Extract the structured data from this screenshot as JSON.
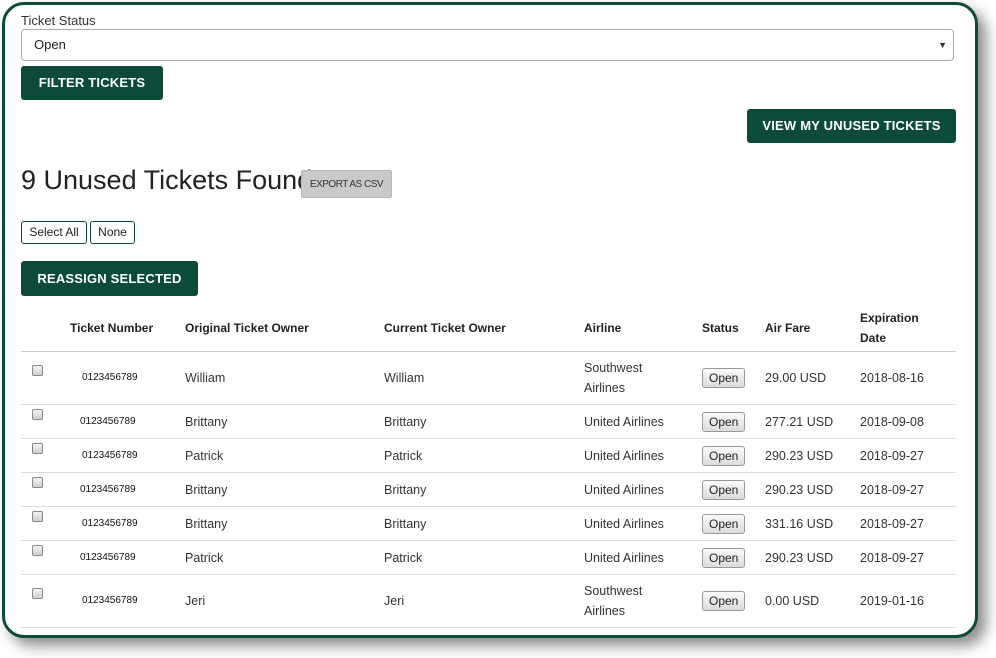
{
  "filter": {
    "label": "Ticket Status",
    "selected": "Open",
    "button": "FILTER TICKETS"
  },
  "view_button": "VIEW MY UNUSED TICKETS",
  "results": {
    "heading": "9 Unused Tickets Found",
    "export_button": "EXPORT AS CSV"
  },
  "selection": {
    "select_all": "Select All",
    "none": "None",
    "reassign": "REASSIGN SELECTED"
  },
  "table": {
    "headers": {
      "ticket_number": "Ticket Number",
      "original_owner": "Original Ticket Owner",
      "current_owner": "Current Ticket Owner",
      "airline": "Airline",
      "status": "Status",
      "air_fare": "Air Fare",
      "expiration_line1": "Expiration",
      "expiration_line2": "Date"
    },
    "rows": [
      {
        "ticket": "0123456789",
        "original": "William",
        "current": "William",
        "airline_l1": "Southwest",
        "airline_l2": "Airlines",
        "status": "Open",
        "fare": "29.00 USD",
        "expiration": "2018-08-16"
      },
      {
        "ticket": "0123456789",
        "original": "Brittany",
        "current": "Brittany",
        "airline_l1": "United Airlines",
        "airline_l2": "",
        "status": "Open",
        "fare": "277.21 USD",
        "expiration": "2018-09-08"
      },
      {
        "ticket": "0123456789",
        "original": "Patrick",
        "current": "Patrick",
        "airline_l1": "United Airlines",
        "airline_l2": "",
        "status": "Open",
        "fare": "290.23 USD",
        "expiration": "2018-09-27"
      },
      {
        "ticket": "0123456789",
        "original": "Brittany",
        "current": "Brittany",
        "airline_l1": "United Airlines",
        "airline_l2": "",
        "status": "Open",
        "fare": "290.23 USD",
        "expiration": "2018-09-27"
      },
      {
        "ticket": "0123456789",
        "original": "Brittany",
        "current": "Brittany",
        "airline_l1": "United Airlines",
        "airline_l2": "",
        "status": "Open",
        "fare": "331.16 USD",
        "expiration": "2018-09-27"
      },
      {
        "ticket": "0123456789",
        "original": "Patrick",
        "current": "Patrick",
        "airline_l1": "United Airlines",
        "airline_l2": "",
        "status": "Open",
        "fare": "290.23 USD",
        "expiration": "2018-09-27"
      },
      {
        "ticket": "0123456789",
        "original": "Jeri",
        "current": "Jeri",
        "airline_l1": "Southwest",
        "airline_l2": "Airlines",
        "status": "Open",
        "fare": "0.00 USD",
        "expiration": "2019-01-16"
      }
    ]
  },
  "colors": {
    "primary": "#0c4a3a",
    "export_bg": "#c9c9c9"
  }
}
